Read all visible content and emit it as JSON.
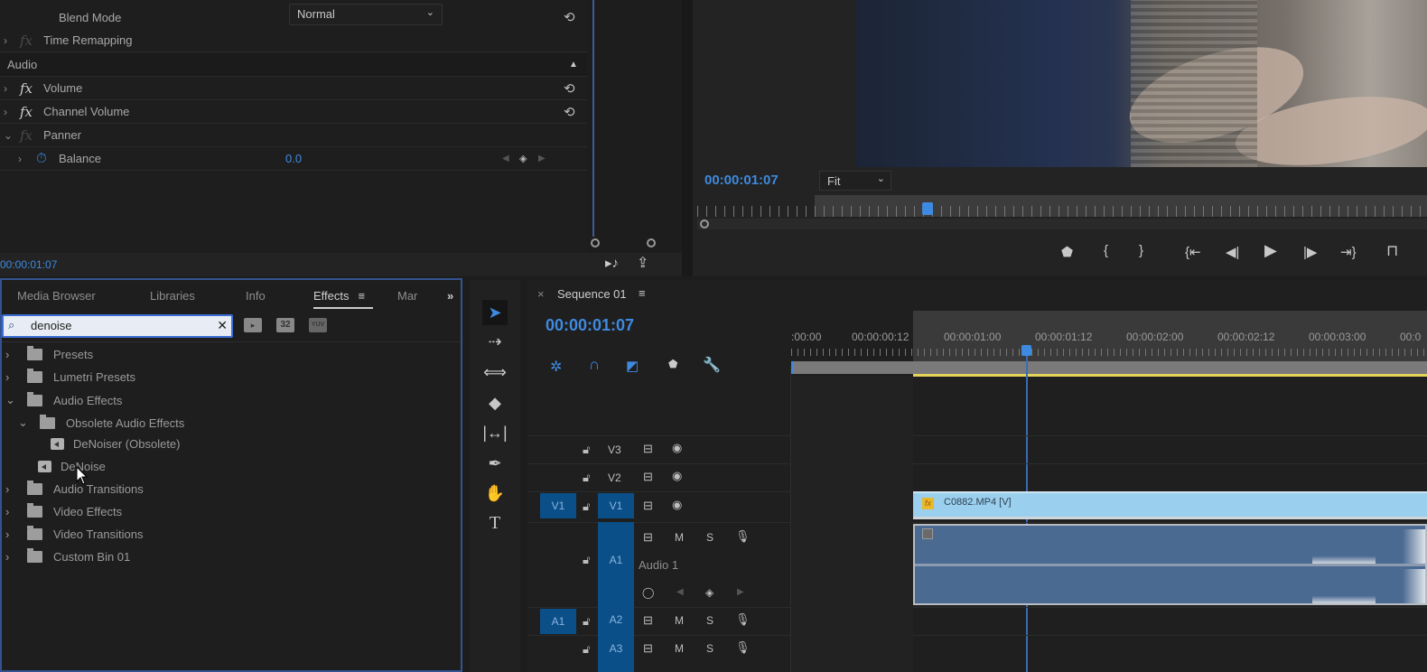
{
  "effect_controls": {
    "blend_mode_label": "Blend Mode",
    "blend_mode_value": "Normal",
    "time_remapping": "Time Remapping",
    "audio_section": "Audio",
    "volume": "Volume",
    "channel_volume": "Channel Volume",
    "panner": "Panner",
    "balance_label": "Balance",
    "balance_value": "0.0",
    "timecode": "00:00:01:07"
  },
  "program_monitor": {
    "timecode": "00:00:01:07",
    "zoom_select": "Fit",
    "transport": [
      "add-marker",
      "mark-in",
      "mark-out",
      "go-to-in",
      "step-back",
      "play",
      "step-forward",
      "go-to-out",
      "lift"
    ]
  },
  "effects_panel": {
    "tabs": [
      "Media Browser",
      "Libraries",
      "Info",
      "Effects",
      "Mar"
    ],
    "active_tab": "Effects",
    "search_value": "denoise",
    "filter_buttons": [
      "accelerated",
      "32",
      "YUV"
    ],
    "tree": [
      {
        "label": "Presets",
        "type": "preset-folder",
        "expanded": false
      },
      {
        "label": "Lumetri Presets",
        "type": "preset-folder",
        "expanded": false
      },
      {
        "label": "Audio Effects",
        "type": "folder",
        "expanded": true
      },
      {
        "label": "Obsolete Audio Effects",
        "type": "folder",
        "expanded": true
      },
      {
        "label": "DeNoiser (Obsolete)",
        "type": "effect"
      },
      {
        "label": "DeNoise",
        "type": "effect"
      },
      {
        "label": "Audio Transitions",
        "type": "folder",
        "expanded": false
      },
      {
        "label": "Video Effects",
        "type": "folder",
        "expanded": false
      },
      {
        "label": "Video Transitions",
        "type": "folder",
        "expanded": false
      },
      {
        "label": "Custom Bin 01",
        "type": "folder",
        "expanded": false
      }
    ]
  },
  "timeline": {
    "sequence_name": "Sequence 01",
    "timecode": "00:00:01:07",
    "ruler_labels": [
      ":00:00",
      "00:00:00:12",
      "00:00:01:00",
      "00:00:01:12",
      "00:00:02:00",
      "00:00:02:12",
      "00:00:03:00",
      "00:0"
    ],
    "tracks": {
      "v3": "V3",
      "v2": "V2",
      "v1": "V1",
      "src_v1": "V1",
      "a1": "A1",
      "a1_name": "Audio 1",
      "a2": "A2",
      "src_a1": "A1",
      "a3": "A3",
      "mute": "M",
      "solo": "S"
    },
    "video_clip": "C0882.MP4 [V]"
  },
  "colors": {
    "accent": "#3e8ae0",
    "clip_video": "#9ad0ee",
    "clip_audio": "#4b6a92",
    "work_area": "#e6d35a"
  }
}
